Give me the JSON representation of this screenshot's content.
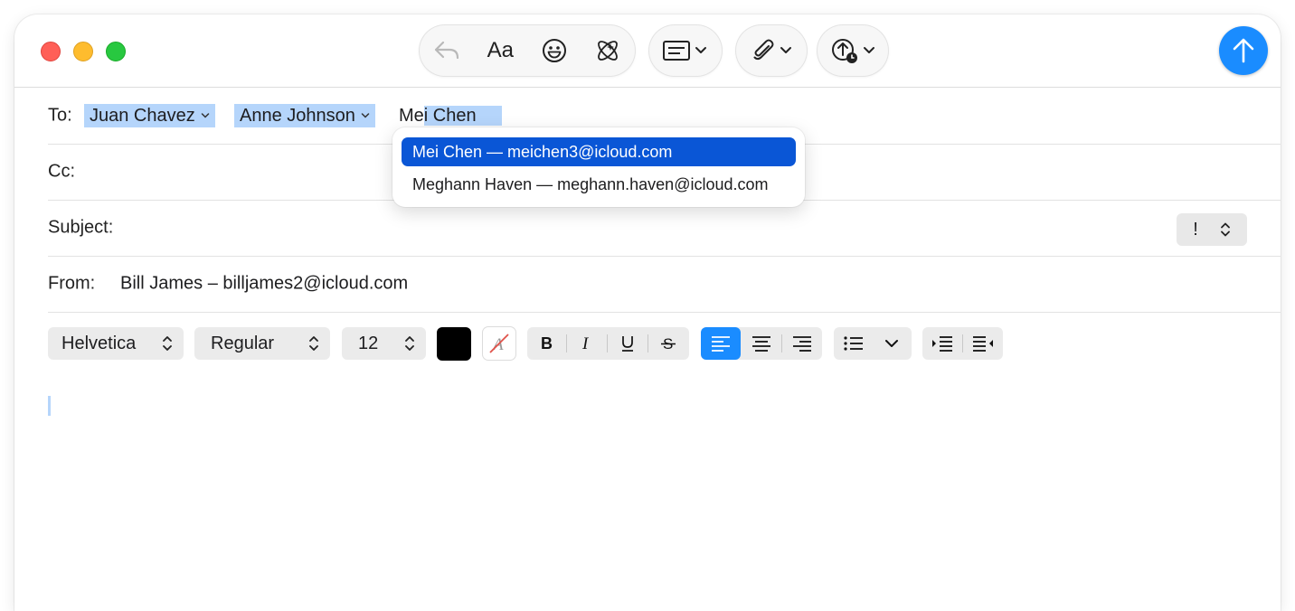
{
  "toolbar": {
    "buttons": [
      {
        "name": "reply-icon"
      },
      {
        "name": "format-text",
        "label": "Aa"
      },
      {
        "name": "emoji-icon"
      },
      {
        "name": "writing-tools-icon"
      },
      {
        "name": "header-fields-icon"
      },
      {
        "name": "attachment-icon"
      },
      {
        "name": "photo-upload-icon"
      }
    ],
    "send_icon": "arrow-up-icon"
  },
  "compose": {
    "to_label": "To:",
    "recipients": [
      "Juan Chavez",
      "Anne Johnson"
    ],
    "typed_plain": "Me",
    "typed_selected": "i Chen",
    "cc_label": "Cc:",
    "subject_label": "Subject:",
    "priority_label": "!",
    "from_label": "From:",
    "from_value": "Bill James – billjames2@icloud.com"
  },
  "suggestions": [
    "Mei Chen — meichen3@icloud.com",
    "Meghann Haven — meghann.haven@icloud.com"
  ],
  "format": {
    "font": "Helvetica",
    "style": "Regular",
    "size": "12",
    "text_color": "#000000",
    "accent": "#1a8cff"
  }
}
